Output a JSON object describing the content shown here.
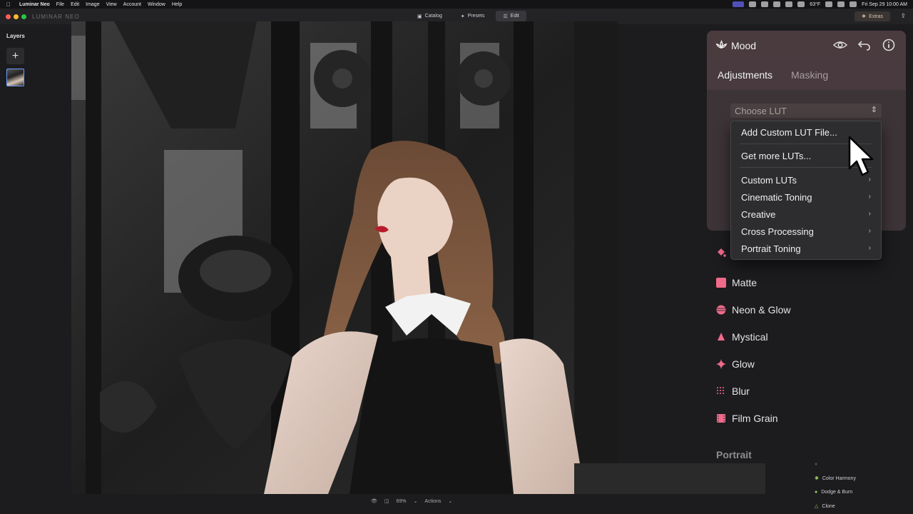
{
  "menubar": {
    "app_name": "Luminar Neo",
    "menus": [
      "File",
      "Edit",
      "Image",
      "View",
      "Account",
      "Window",
      "Help"
    ],
    "weather": "63°F",
    "datetime": "Fri Sep 29  10:00 AM"
  },
  "titlebar": {
    "app_logo_text": "LUMINAR NEO",
    "tabs": [
      {
        "label": "Catalog",
        "icon": "catalog-icon"
      },
      {
        "label": "Presets",
        "icon": "presets-icon"
      },
      {
        "label": "Edit",
        "icon": "edit-icon",
        "active": true
      }
    ],
    "extras_label": "Extras"
  },
  "layers": {
    "title": "Layers",
    "add_label": "+"
  },
  "bottom_bar": {
    "zoom": "69%",
    "actions_label": "Actions"
  },
  "mood_panel": {
    "title": "Mood",
    "tabs": [
      "Adjustments",
      "Masking"
    ],
    "active_tab": "Adjustments",
    "lut_placeholder": "Choose LUT"
  },
  "lut_dropdown": {
    "items": [
      {
        "label": "Add Custom LUT File...",
        "submenu": false
      },
      {
        "label": "Get more LUTs...",
        "submenu": false
      },
      {
        "label": "Custom LUTs",
        "submenu": true
      },
      {
        "label": "Cinematic Toning",
        "submenu": true
      },
      {
        "label": "Creative",
        "submenu": true
      },
      {
        "label": "Cross Processing",
        "submenu": true
      },
      {
        "label": "Portrait Toning",
        "submenu": true
      }
    ]
  },
  "creative_tools": [
    {
      "label": "Matte",
      "icon": "matte-icon"
    },
    {
      "label": "Neon & Glow",
      "icon": "neon-glow-icon"
    },
    {
      "label": "Mystical",
      "icon": "mystical-icon"
    },
    {
      "label": "Glow",
      "icon": "glow-icon"
    },
    {
      "label": "Blur",
      "icon": "blur-icon"
    },
    {
      "label": "Film Grain",
      "icon": "film-grain-icon"
    }
  ],
  "portrait_section": {
    "title": "Portrait",
    "tools": [
      {
        "label": "Color Harmony",
        "icon": "color-harmony-icon"
      },
      {
        "label": "Dodge & Burn",
        "icon": "dodge-burn-icon"
      },
      {
        "label": "Clone",
        "icon": "clone-icon"
      }
    ]
  },
  "colors": {
    "accent_pink": "#f06a8a",
    "panel_bg": "#3d3437",
    "header_bg": "#4a3b3f"
  }
}
